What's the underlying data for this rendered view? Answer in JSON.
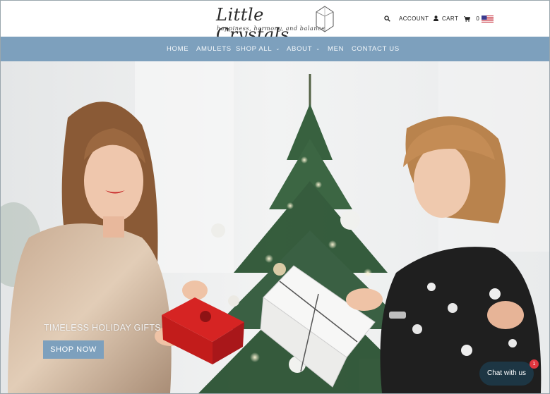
{
  "brand": {
    "name": "Little Crystals",
    "tagline": "happiness, harmony, and balance"
  },
  "header": {
    "account_label": "ACCOUNT",
    "cart_label": "CART",
    "cart_count": "0",
    "icons": [
      "search-icon",
      "user-icon",
      "cart-icon",
      "us-flag-icon"
    ]
  },
  "nav": {
    "items": [
      {
        "label": "HOME"
      },
      {
        "label": "AMULETS"
      },
      {
        "label": "SHOP ALL",
        "dropdown": true
      },
      {
        "label": "ABOUT",
        "dropdown": true
      },
      {
        "label": "MEN"
      },
      {
        "label": "CONTACT US"
      }
    ]
  },
  "hero": {
    "caption": "TIMELESS HOLIDAY GIFTS",
    "button_label": "SHOP NOW"
  },
  "chat": {
    "label": "Chat with us",
    "badge": "1"
  },
  "colors": {
    "nav_bg": "#7da0bd",
    "chat_bg": "#1d3644",
    "badge": "#e0363f"
  }
}
